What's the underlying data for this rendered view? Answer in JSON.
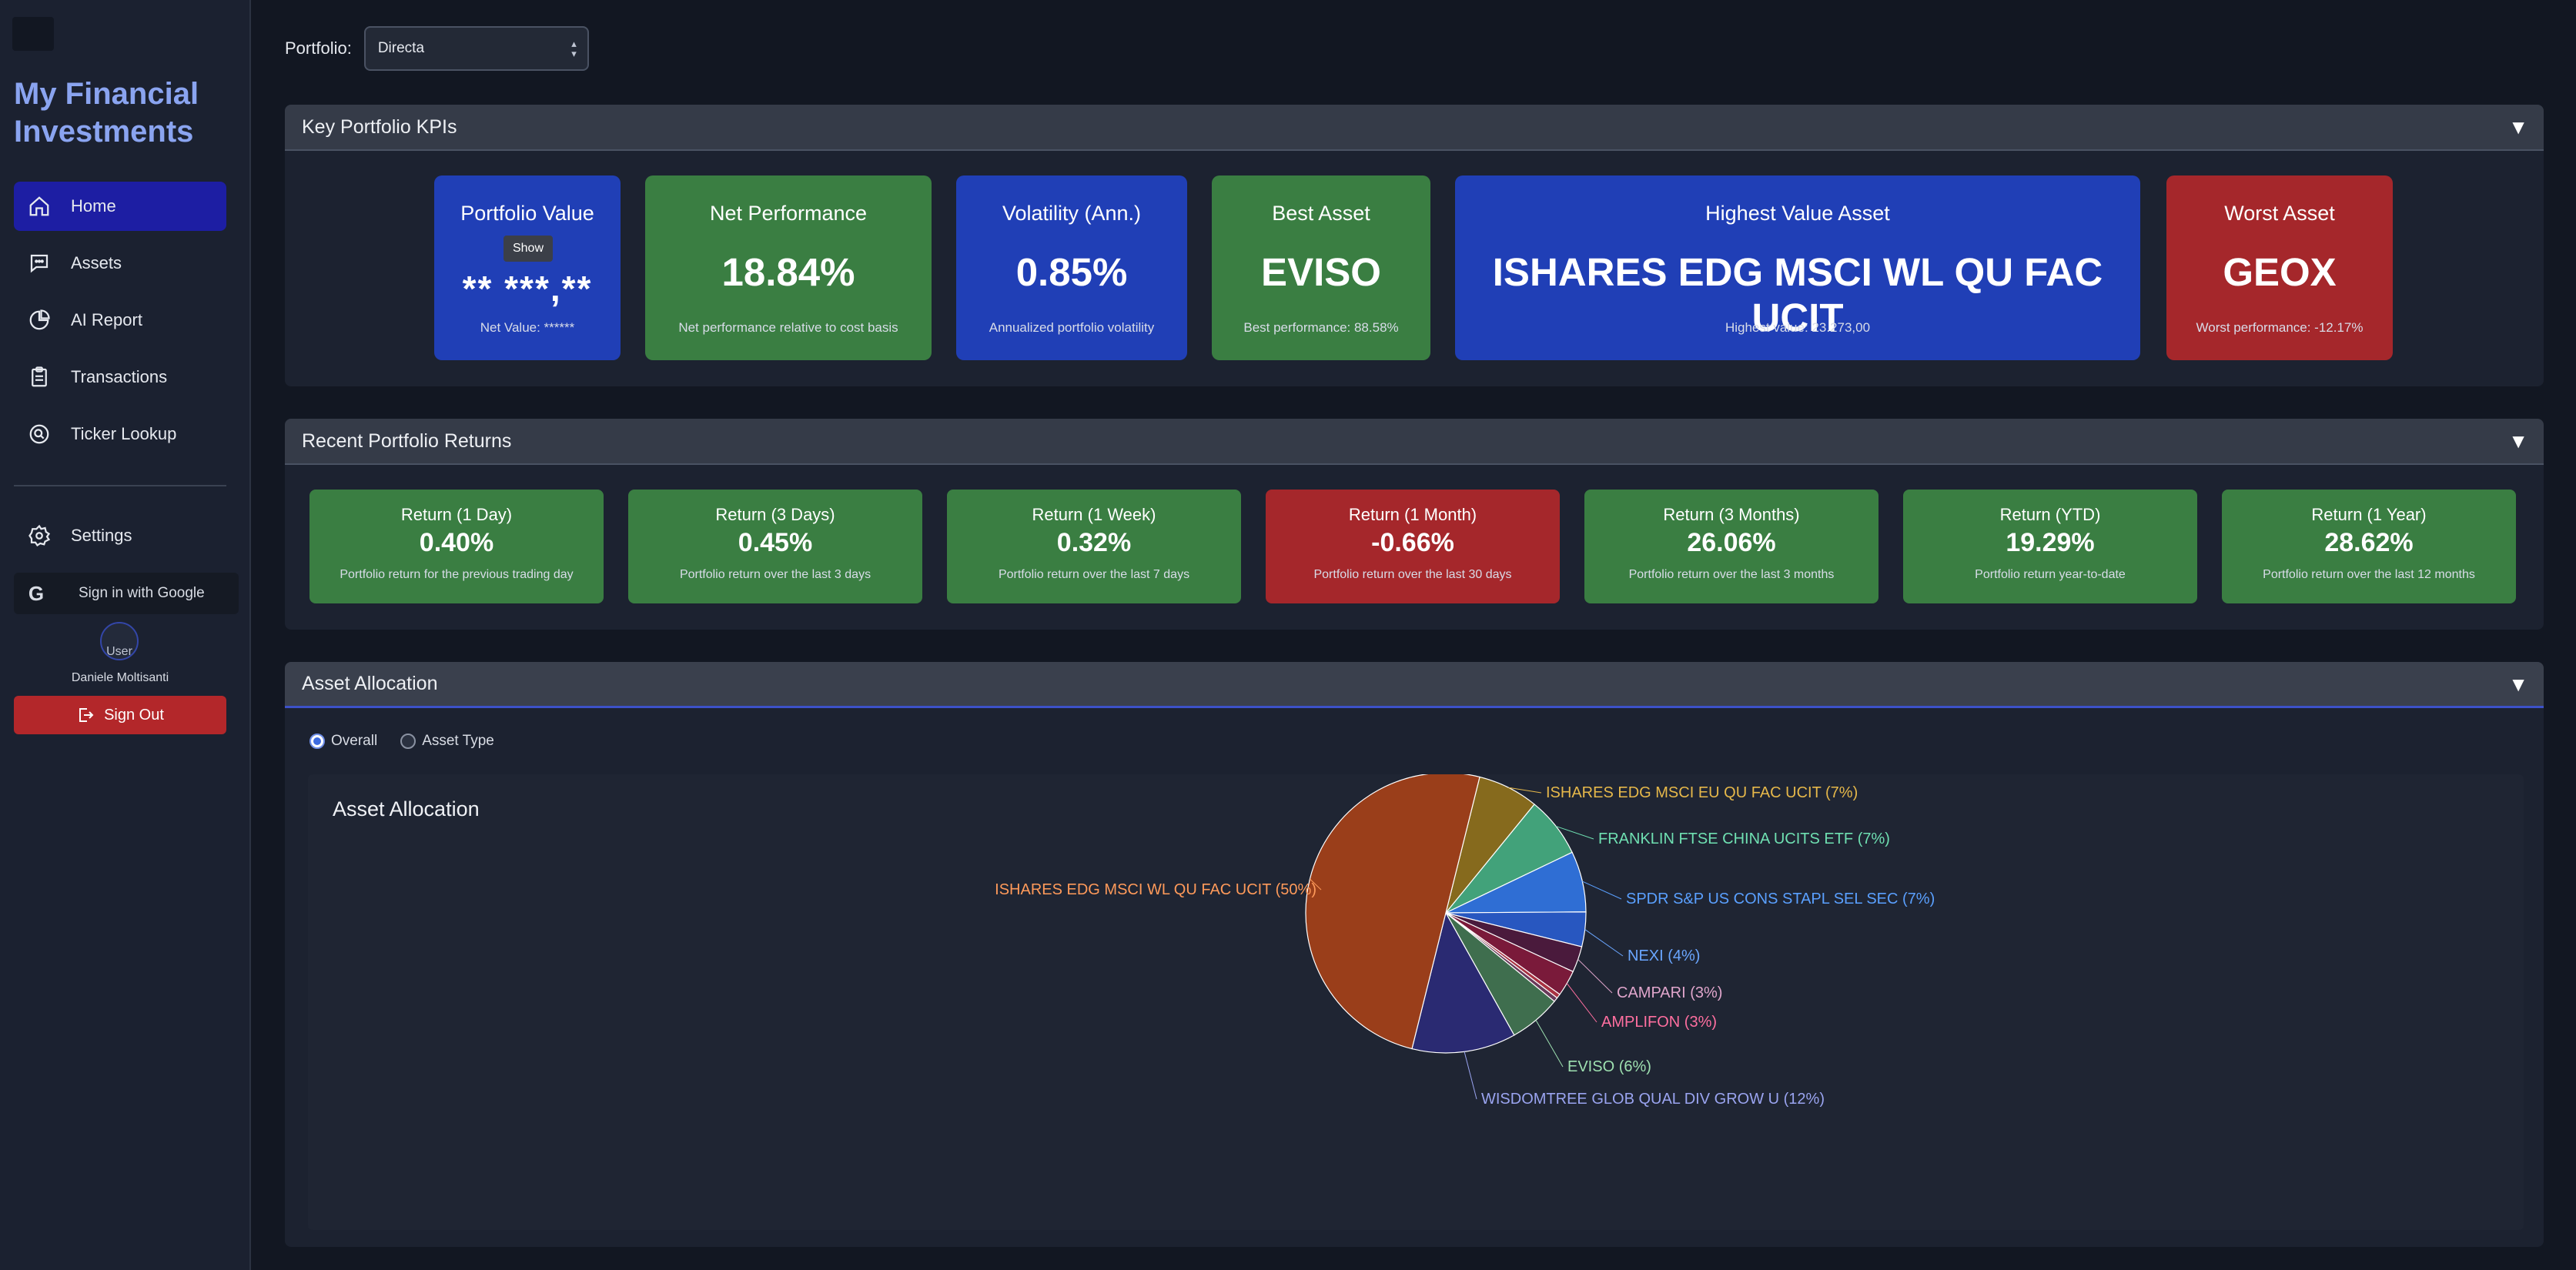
{
  "app": {
    "title": "My Financial Investments"
  },
  "nav": {
    "items": [
      {
        "label": "Home",
        "icon": "home-icon",
        "active": true
      },
      {
        "label": "Assets",
        "icon": "chat-icon"
      },
      {
        "label": "AI Report",
        "icon": "pie-chart-icon"
      },
      {
        "label": "Transactions",
        "icon": "clipboard-icon"
      },
      {
        "label": "Ticker Lookup",
        "icon": "search-icon"
      }
    ],
    "settings": "Settings"
  },
  "auth": {
    "google_label": "Sign in with Google",
    "avatar_alt": "User",
    "user_name": "Daniele Moltisanti",
    "signout_label": "Sign Out"
  },
  "portfolio": {
    "label": "Portfolio:",
    "selected": "Directa"
  },
  "kpi_section": {
    "title": "Key Portfolio KPIs",
    "cards": [
      {
        "title": "Portfolio Value",
        "value": "** ***,**",
        "sub": "Net Value: ******",
        "show": "Show",
        "color": "#203fb6"
      },
      {
        "title": "Net Performance",
        "value": "18.84%",
        "sub": "Net performance relative to cost basis",
        "color": "#3a7e42"
      },
      {
        "title": "Volatility (Ann.)",
        "value": "0.85%",
        "sub": "Annualized portfolio volatility",
        "color": "#203fb6"
      },
      {
        "title": "Best Asset",
        "value": "EVISO",
        "sub": "Best performance: 88.58%",
        "color": "#3a7e42"
      },
      {
        "title": "Highest Value Asset",
        "value": "ISHARES EDG MSCI WL QU FAC UCIT",
        "sub": "Highest value: 23.273,00",
        "color": "#203fb6"
      },
      {
        "title": "Worst Asset",
        "value": "GEOX",
        "sub": "Worst performance: -12.17%",
        "color": "#a5272b"
      }
    ]
  },
  "returns_section": {
    "title": "Recent Portfolio Returns",
    "cards": [
      {
        "title": "Return (1 Day)",
        "value": "0.40%",
        "sub": "Portfolio return for the previous trading day",
        "color": "#3a7e42"
      },
      {
        "title": "Return (3 Days)",
        "value": "0.45%",
        "sub": "Portfolio return over the last 3 days",
        "color": "#3a7e42"
      },
      {
        "title": "Return (1 Week)",
        "value": "0.32%",
        "sub": "Portfolio return over the last 7 days",
        "color": "#3a7e42"
      },
      {
        "title": "Return (1 Month)",
        "value": "-0.66%",
        "sub": "Portfolio return over the last 30 days",
        "color": "#a5272b"
      },
      {
        "title": "Return (3 Months)",
        "value": "26.06%",
        "sub": "Portfolio return over the last 3 months",
        "color": "#3a7e42"
      },
      {
        "title": "Return (YTD)",
        "value": "19.29%",
        "sub": "Portfolio return year-to-date",
        "color": "#3a7e42"
      },
      {
        "title": "Return (1 Year)",
        "value": "28.62%",
        "sub": "Portfolio return over the last 12 months",
        "color": "#3a7e42"
      }
    ]
  },
  "allocation_section": {
    "title": "Asset Allocation",
    "radio_options": [
      "Overall",
      "Asset Type"
    ],
    "radio_selected": "Overall"
  },
  "chart_data": {
    "type": "pie",
    "title": "Asset Allocation",
    "slices": [
      {
        "label": "ISHARES EDG MSCI EU QU FAC UCIT (7%)",
        "value": 7,
        "color": "#866a1d",
        "text_color": "#e6b84a"
      },
      {
        "label": "FRANKLIN FTSE CHINA UCITS ETF (7%)",
        "value": 7,
        "color": "#42a27a",
        "text_color": "#6fe0b2"
      },
      {
        "label": "SPDR S&P US CONS STAPL SEL SEC (7%)",
        "value": 7,
        "color": "#2f6ed4",
        "text_color": "#5aa0ff"
      },
      {
        "label": "NEXI (4%)",
        "value": 4,
        "color": "#2857c0",
        "text_color": "#6aa6ff"
      },
      {
        "label": "CAMPARI (3%)",
        "value": 3,
        "color": "#4a1a3c",
        "text_color": "#e0a6cc"
      },
      {
        "label": "AMPLIFON (3%)",
        "value": 3,
        "color": "#7a1a3a",
        "text_color": "#ff6fa0"
      },
      {
        "label": "",
        "value": 0.5,
        "color": "#a83242",
        "text_color": "#ff8a9a"
      },
      {
        "label": "",
        "value": 0.5,
        "color": "#6a3a5a",
        "text_color": "#cc88aa"
      },
      {
        "label": "EVISO (6%)",
        "value": 6,
        "color": "#3f6e4e",
        "text_color": "#9ee0b0"
      },
      {
        "label": "WISDOMTREE GLOB QUAL DIV GROW U (12%)",
        "value": 12,
        "color": "#2a2a72",
        "text_color": "#9aa4f0"
      },
      {
        "label": "ISHARES EDG MSCI WL QU FAC UCIT (50%)",
        "value": 50,
        "color": "#9a3e1a",
        "text_color": "#ff9a5a"
      }
    ]
  }
}
